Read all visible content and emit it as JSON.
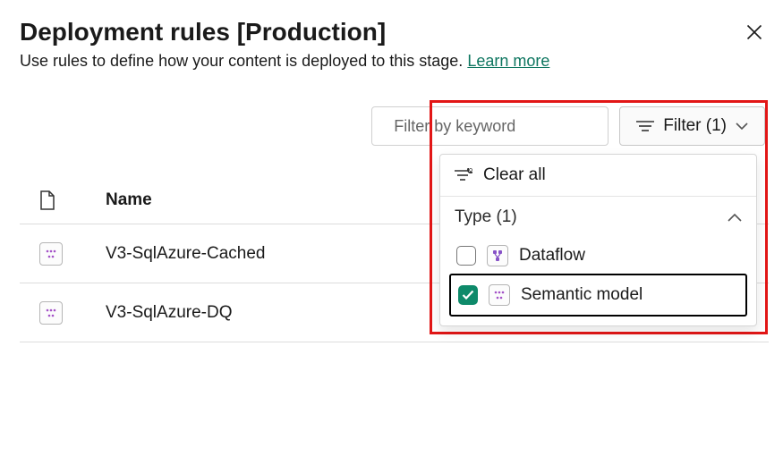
{
  "header": {
    "title": "Deployment rules [Production]",
    "subtitle_prefix": "Use rules to define how your content is deployed to this stage.",
    "learn_more": "Learn more"
  },
  "search": {
    "placeholder": "Filter by keyword"
  },
  "filter_button": {
    "label": "Filter (1)"
  },
  "table": {
    "name_header": "Name",
    "rows": [
      {
        "name": "V3-SqlAzure-Cached"
      },
      {
        "name": "V3-SqlAzure-DQ"
      }
    ]
  },
  "filter_panel": {
    "clear_all": "Clear all",
    "type_header": "Type (1)",
    "options": [
      {
        "label": "Dataflow",
        "checked": false
      },
      {
        "label": "Semantic model",
        "checked": true
      }
    ]
  }
}
